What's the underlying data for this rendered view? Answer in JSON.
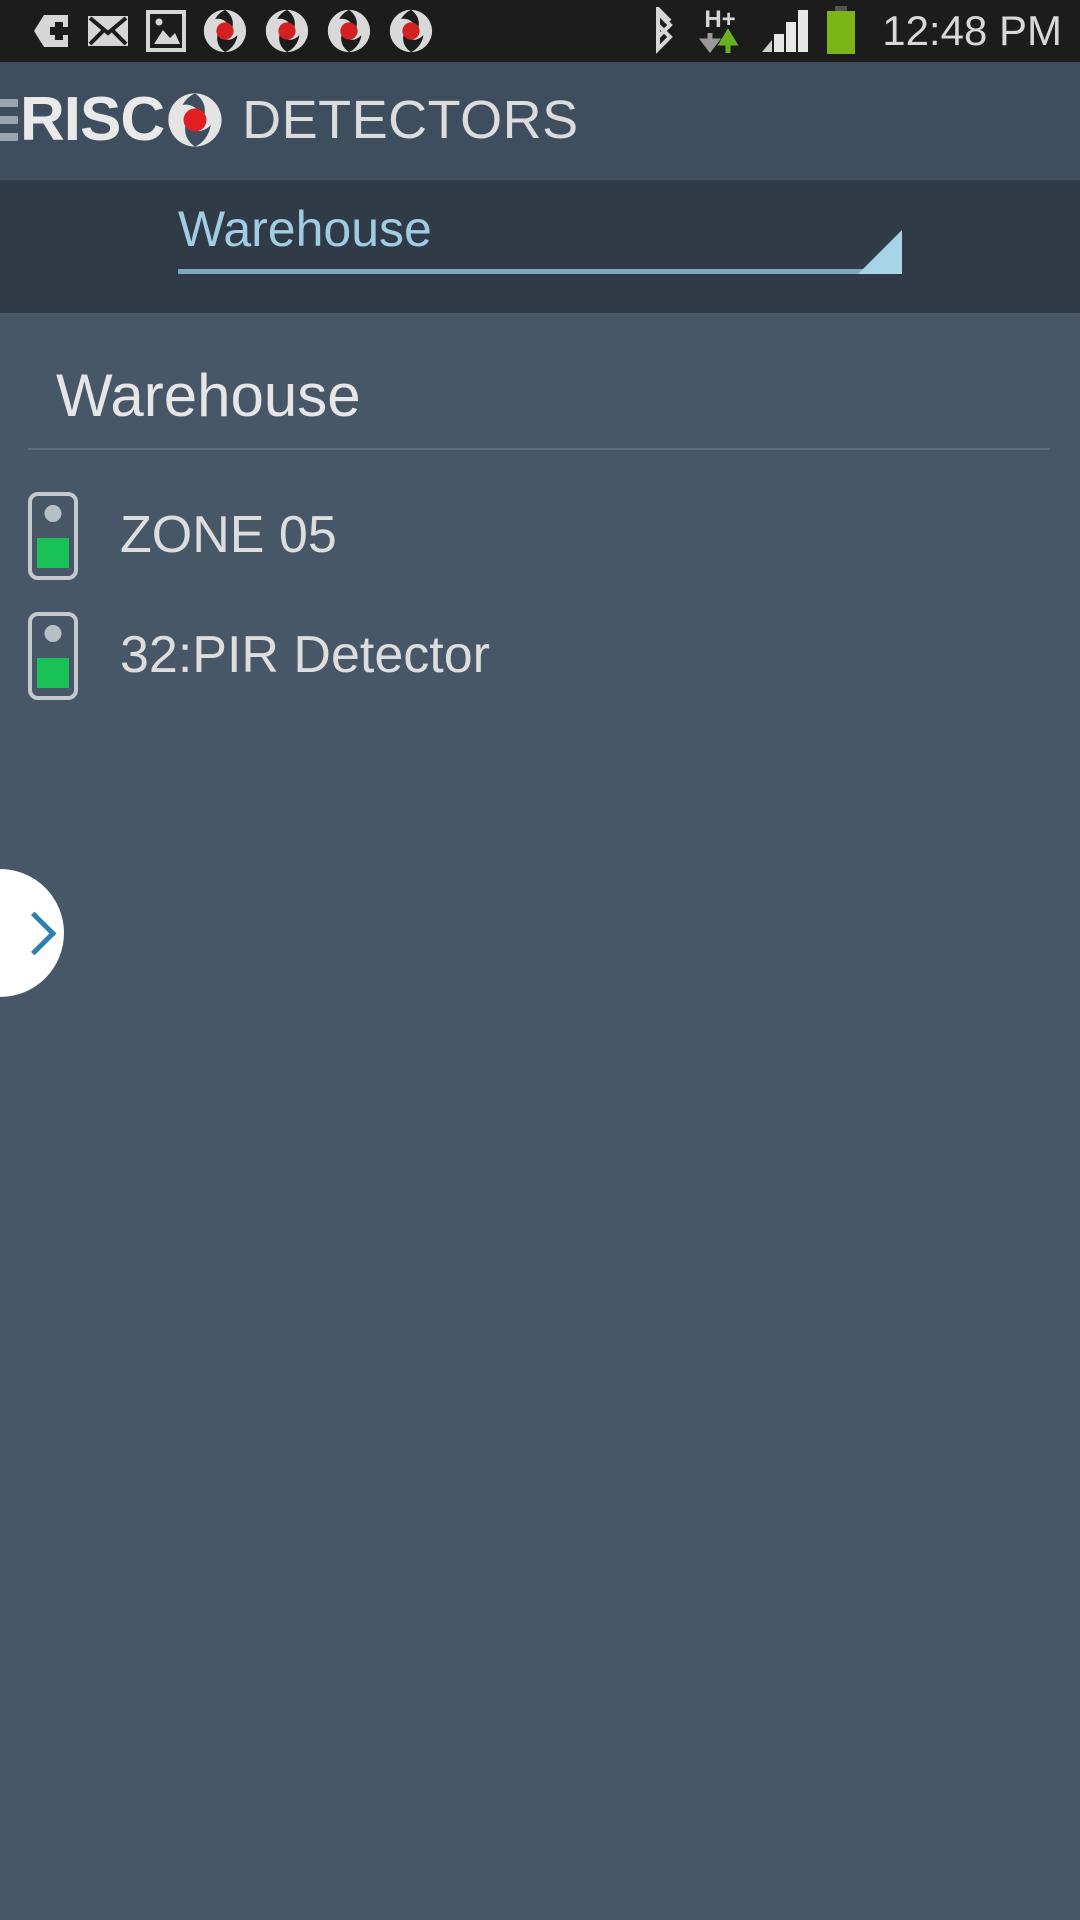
{
  "statusbar": {
    "time": "12:48 PM",
    "icons": [
      {
        "name": "tag-plus-icon",
        "glyph": "tag-plus"
      },
      {
        "name": "email-icon",
        "glyph": "envelope"
      },
      {
        "name": "gallery-image-icon",
        "glyph": "image"
      },
      {
        "name": "risco-notification-icon-1",
        "glyph": "risco-aperture"
      },
      {
        "name": "risco-notification-icon-2",
        "glyph": "risco-aperture"
      },
      {
        "name": "risco-notification-icon-3",
        "glyph": "risco-aperture"
      },
      {
        "name": "risco-notification-icon-4",
        "glyph": "risco-aperture"
      }
    ],
    "bluetooth_icon": "bluetooth-icon",
    "network_type": "H+",
    "network_icon": "hspa-plus-data-icon",
    "signal_icon": "signal-bars-icon",
    "signal_bars": 4,
    "battery_icon": "battery-icon",
    "battery_color": "#7cb518"
  },
  "appbar": {
    "menu_icon": "hamburger-menu-icon",
    "brand": "RISC",
    "brand_mark_icon": "risco-aperture-logo",
    "title": "DETECTORS"
  },
  "spinner": {
    "selected": "Warehouse",
    "caret_icon": "dropdown-caret-icon",
    "accent_color": "#9fcde2"
  },
  "content": {
    "section_title": "Warehouse",
    "detectors": [
      {
        "label": "ZONE 05",
        "icon": "detector-icon",
        "status_color": "#19c257"
      },
      {
        "label": "32:PIR Detector",
        "icon": "detector-icon",
        "status_color": "#19c257"
      }
    ]
  },
  "drawer_handle": {
    "name": "drawer-handle",
    "chevron_icon": "chevron-right-icon"
  }
}
